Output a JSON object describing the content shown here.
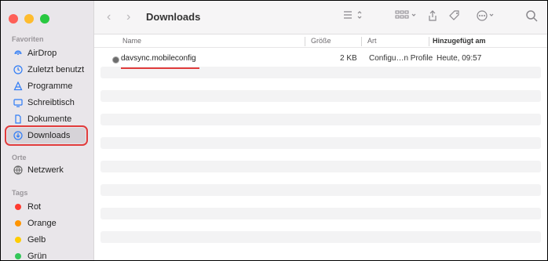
{
  "window": {
    "title": "Downloads"
  },
  "sidebar": {
    "sections": [
      {
        "title": "Favoriten",
        "items": [
          {
            "label": "AirDrop",
            "icon": "airdrop-icon"
          },
          {
            "label": "Zuletzt benutzt",
            "icon": "clock-icon"
          },
          {
            "label": "Programme",
            "icon": "apps-icon"
          },
          {
            "label": "Schreibtisch",
            "icon": "desktop-icon"
          },
          {
            "label": "Dokumente",
            "icon": "document-icon"
          },
          {
            "label": "Downloads",
            "icon": "download-icon",
            "active": true
          }
        ]
      },
      {
        "title": "Orte",
        "items": [
          {
            "label": "Netzwerk",
            "icon": "network-icon"
          }
        ]
      },
      {
        "title": "Tags",
        "items": [
          {
            "label": "Rot",
            "color": "#ff3b30"
          },
          {
            "label": "Orange",
            "color": "#ff9500"
          },
          {
            "label": "Gelb",
            "color": "#ffcc00"
          },
          {
            "label": "Grün",
            "color": "#34c759"
          }
        ]
      }
    ]
  },
  "columns": {
    "name": "Name",
    "size": "Größe",
    "kind": "Art",
    "date": "Hinzugefügt am"
  },
  "files": [
    {
      "name": "davsync.mobileconfig",
      "size": "2 KB",
      "kind": "Configu…n Profile",
      "date": "Heute, 09:57"
    }
  ]
}
